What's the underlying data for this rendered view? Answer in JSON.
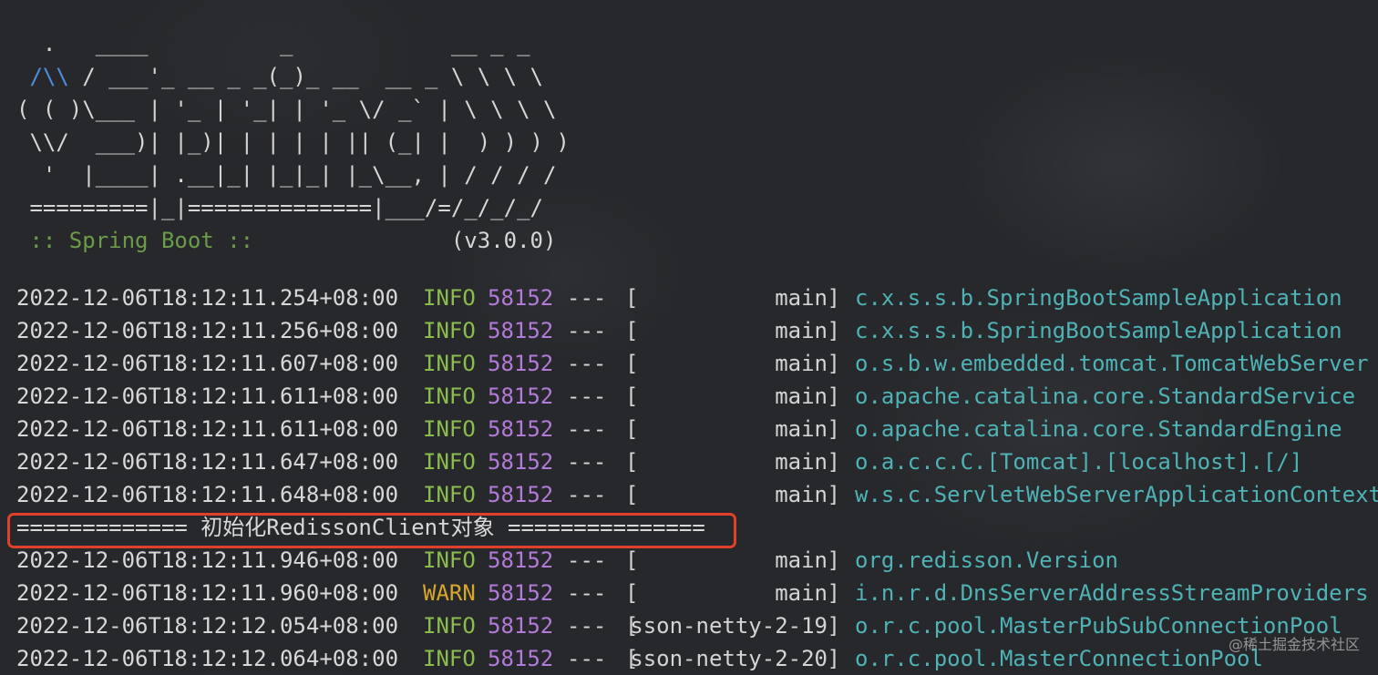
{
  "banner": {
    "line1": "  .   ____          _            __ _ _",
    "line2_icon": "/\\\\",
    "line2_rest": " / ___'_ __ _ _(_)_ __  __ _ \\ \\ \\ \\",
    "line3": "( ( )\\___ | '_ | '_| | '_ \\/ _` | \\ \\ \\ \\",
    "line4": " \\\\/  ___)| |_)| | | | | || (_| |  ) ) ) )",
    "line5": "  '  |____| .__|_| |_|_| |_\\__, | / / / /",
    "line6": " =========|_|==============|___/=/_/_/_/",
    "spring_label": " :: Spring Boot :: ",
    "version_pad": "              ",
    "version": "(v3.0.0)"
  },
  "logs": [
    {
      "ts": "2022-12-06T18:12:11.254+08:00",
      "level": "INFO",
      "pid": "58152",
      "sep": "---",
      "thread": "main",
      "logger": "c.x.s.s.b.SpringBootSampleApplication"
    },
    {
      "ts": "2022-12-06T18:12:11.256+08:00",
      "level": "INFO",
      "pid": "58152",
      "sep": "---",
      "thread": "main",
      "logger": "c.x.s.s.b.SpringBootSampleApplication"
    },
    {
      "ts": "2022-12-06T18:12:11.607+08:00",
      "level": "INFO",
      "pid": "58152",
      "sep": "---",
      "thread": "main",
      "logger": "o.s.b.w.embedded.tomcat.TomcatWebServer"
    },
    {
      "ts": "2022-12-06T18:12:11.611+08:00",
      "level": "INFO",
      "pid": "58152",
      "sep": "---",
      "thread": "main",
      "logger": "o.apache.catalina.core.StandardService"
    },
    {
      "ts": "2022-12-06T18:12:11.611+08:00",
      "level": "INFO",
      "pid": "58152",
      "sep": "---",
      "thread": "main",
      "logger": "o.apache.catalina.core.StandardEngine"
    },
    {
      "ts": "2022-12-06T18:12:11.647+08:00",
      "level": "INFO",
      "pid": "58152",
      "sep": "---",
      "thread": "main",
      "logger": "o.a.c.c.C.[Tomcat].[localhost].[/]"
    },
    {
      "ts": "2022-12-06T18:12:11.648+08:00",
      "level": "INFO",
      "pid": "58152",
      "sep": "---",
      "thread": "main",
      "logger": "w.s.c.ServletWebServerApplicationContext"
    },
    {
      "ts": "2022-12-06T18:12:11.946+08:00",
      "level": "INFO",
      "pid": "58152",
      "sep": "---",
      "thread": "main",
      "logger": "org.redisson.Version"
    },
    {
      "ts": "2022-12-06T18:12:11.960+08:00",
      "level": "WARN",
      "pid": "58152",
      "sep": "---",
      "thread": "main",
      "logger": "i.n.r.d.DnsServerAddressStreamProviders"
    },
    {
      "ts": "2022-12-06T18:12:12.054+08:00",
      "level": "INFO",
      "pid": "58152",
      "sep": "---",
      "thread": "sson-netty-2-19",
      "logger": "o.r.c.pool.MasterPubSubConnectionPool"
    },
    {
      "ts": "2022-12-06T18:12:12.064+08:00",
      "level": "INFO",
      "pid": "58152",
      "sep": "---",
      "thread": "sson-netty-2-20",
      "logger": "o.r.c.pool.MasterConnectionPool"
    }
  ],
  "redisson_line": "============= 初始化RedissonClient对象 ===============",
  "watermark": "@稀土掘金技术社区",
  "colors": {
    "background": "#27282b",
    "info": "#8bbd4c",
    "warn": "#d6a72b",
    "pid": "#b27ad9",
    "logger": "#4fb3b5",
    "highlight": "#e0412c",
    "spring": "#6c9b49",
    "banner_icon": "#4a8fe0"
  }
}
